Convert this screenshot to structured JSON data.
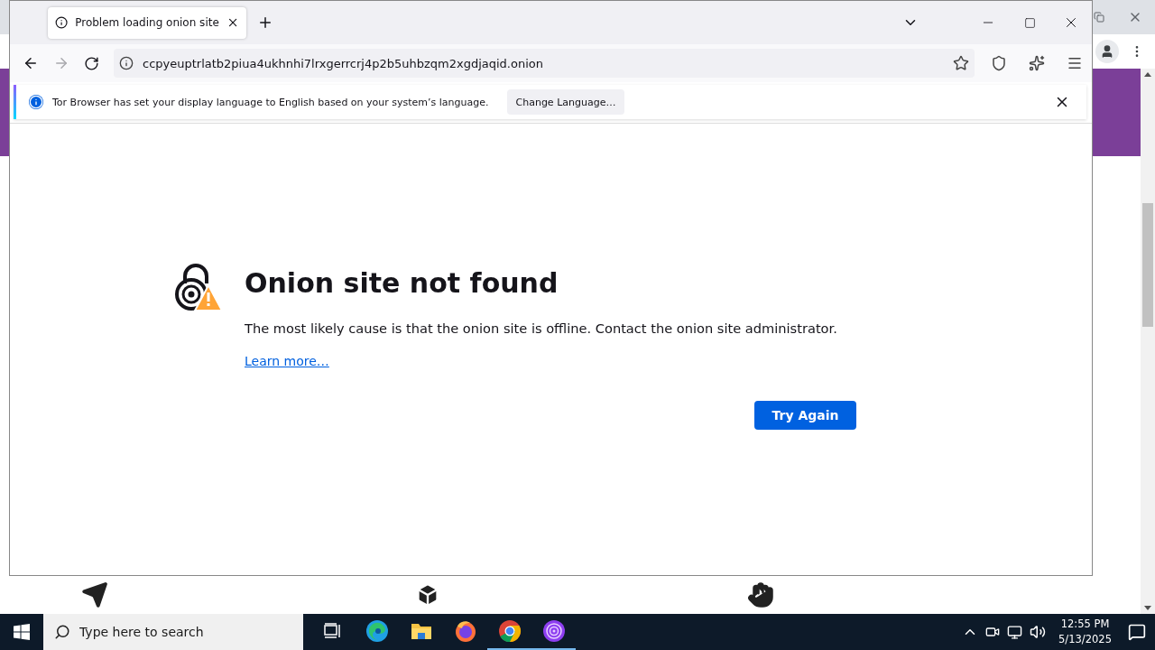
{
  "window": {
    "tabs": [
      {
        "title": "Problem loading onion site",
        "selected": true
      }
    ],
    "address": "ccpyeuptrlatb2piua4ukhnhi7lrxgerrcrj4p2b5uhbzqm2xgdjaqid.onion",
    "nav": {
      "back_disabled": false,
      "forward_disabled": true
    },
    "notification": {
      "message": "Tor Browser has set your display language to English based on your system’s language.",
      "button": "Change Language…"
    },
    "error": {
      "title": "Onion site not found",
      "message": "The most likely cause is that the onion site is offline. Contact the onion site administrator.",
      "link": "Learn more…",
      "button": "Try Again"
    }
  },
  "taskbar": {
    "search": {
      "placeholder": "Type here to search"
    },
    "apps": [
      {
        "kind": "taskview",
        "running": false
      },
      {
        "kind": "edge",
        "running": false
      },
      {
        "kind": "explorer",
        "running": false
      },
      {
        "kind": "firefox",
        "running": false
      },
      {
        "kind": "chrome",
        "running": true
      },
      {
        "kind": "tor",
        "running": true
      }
    ],
    "time": "12:55 PM",
    "date": "5/13/2025"
  }
}
